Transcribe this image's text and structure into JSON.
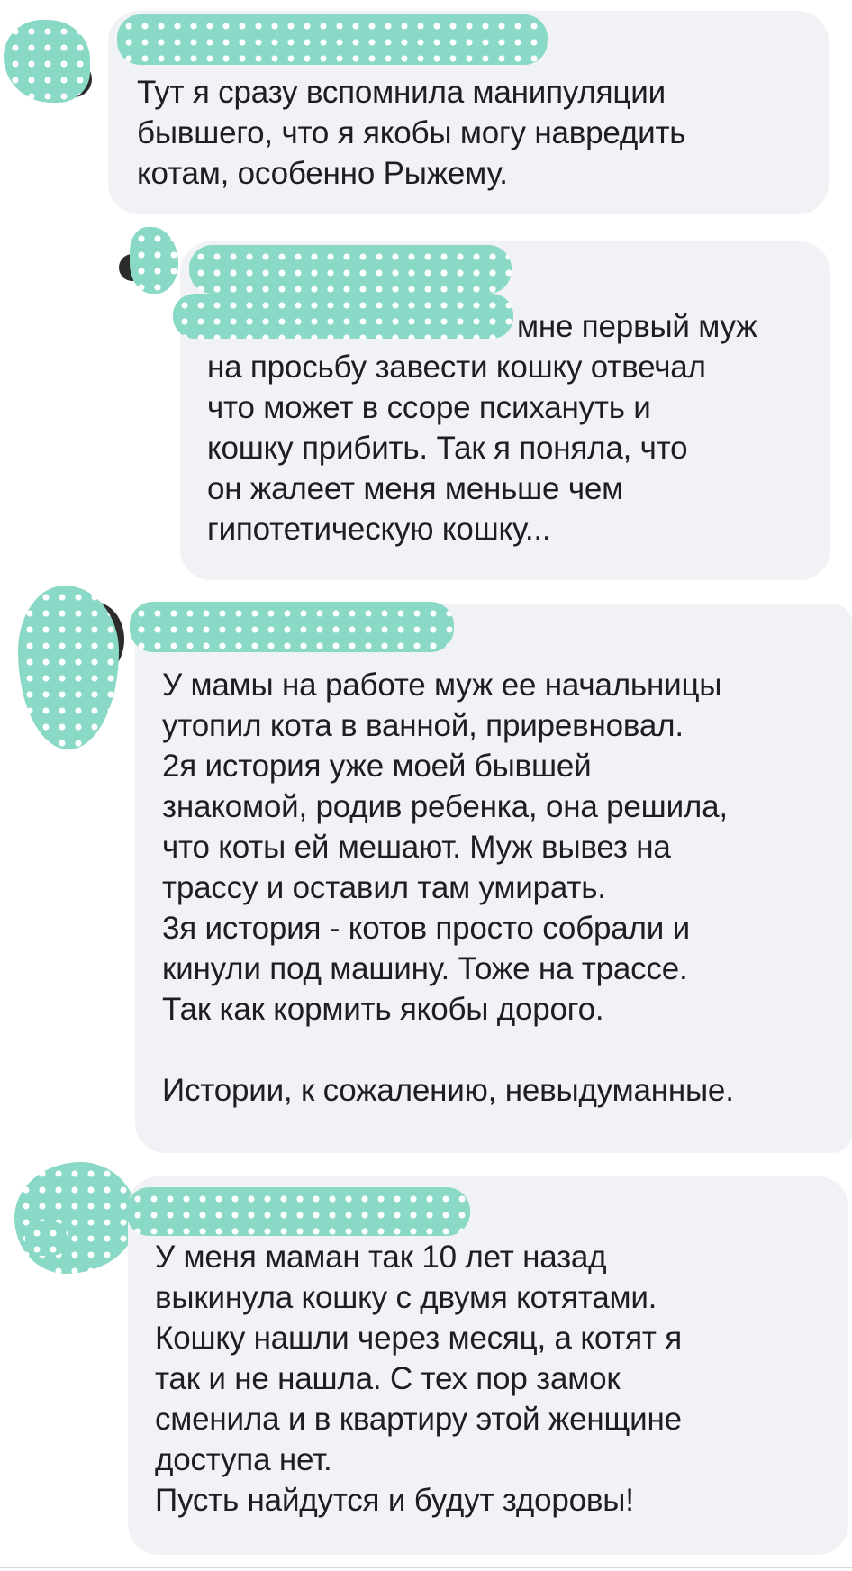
{
  "comments": [
    {
      "text": "Тут я сразу вспомнила манипуляции\nбывшего, что я якобы могу навредить\nкотам, особенно Рыжему."
    },
    {
      "mention_tail": "мне первый муж",
      "text": "на просьбу завести кошку отвечал\nчто может в ссоре психануть и\nкошку прибить. Так я поняла, что\nон жалеет меня меньше чем\nгипотетическую кошку..."
    },
    {
      "text": "У мамы на работе муж ее начальницы\nутопил кота в ванной, приревновал.\n2я история уже моей бывшей\nзнакомой, родив ребенка, она решила,\nчто коты ей мешают. Муж вывез на\nтрассу и оставил там умирать.\n3я история - котов просто собрали и\nкинули под машину. Тоже на трассе.\nТак как кормить якобы дорого.\n\nИстории, к сожалению, невыдуманные."
    },
    {
      "text": "У меня маман так 10 лет назад\nвыкинула кошку с двумя котятами.\nКошку нашли через месяц, а котят я\nтак и не нашла. С тех пор замок\nсменила и в квартиру этой женщине\nдоступа нет.\nПусть найдутся и будут здоровы!"
    }
  ],
  "redaction_color": "#8ad9c7",
  "bubble_color": "#f0f2f5"
}
